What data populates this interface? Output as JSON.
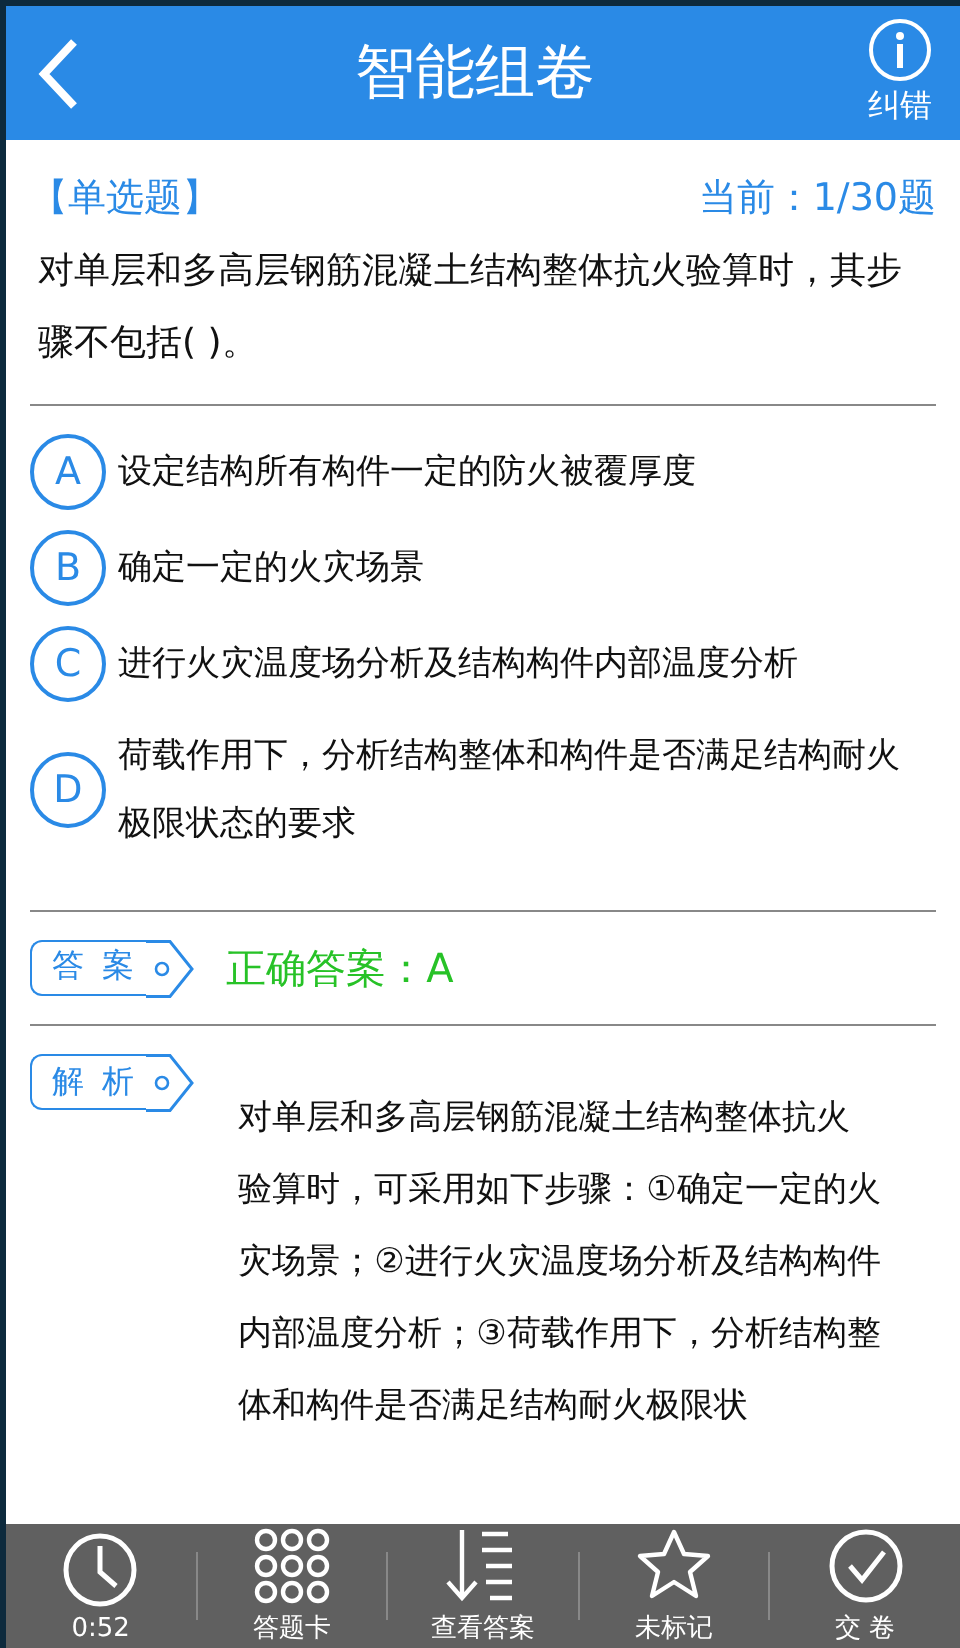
{
  "header": {
    "title": "智能组卷",
    "report_label": "纠错"
  },
  "question": {
    "type_label": "【单选题】",
    "progress": "当前：1/30题",
    "text": "对单层和多高层钢筋混凝土结构整体抗火验算时，其步骤不包括(    )。"
  },
  "options": [
    {
      "letter": "A",
      "text": "设定结构所有构件一定的防火被覆厚度"
    },
    {
      "letter": "B",
      "text": "确定一定的火灾场景"
    },
    {
      "letter": "C",
      "text": "进行火灾温度场分析及结构构件内部温度分析"
    },
    {
      "letter": "D",
      "text": "荷载作用下，分析结构整体和构件是否满足结构耐火极限状态的要求"
    }
  ],
  "answer": {
    "tag": "答 案",
    "text": "正确答案：A"
  },
  "explanation": {
    "tag": "解 析",
    "text": "对单层和多高层钢筋混凝土结构整体抗火验算时，可采用如下步骤：①确定一定的火灾场景；②进行火灾温度场分析及结构构件内部温度分析；③荷载作用下，分析结构整体和构件是否满足结构耐火极限状"
  },
  "toolbar": [
    {
      "kind": "timer",
      "label": "0:52"
    },
    {
      "kind": "card",
      "label": "答题卡"
    },
    {
      "kind": "answers",
      "label": "查看答案"
    },
    {
      "kind": "mark",
      "label": "未标记"
    },
    {
      "kind": "submit",
      "label": "交 卷"
    }
  ]
}
